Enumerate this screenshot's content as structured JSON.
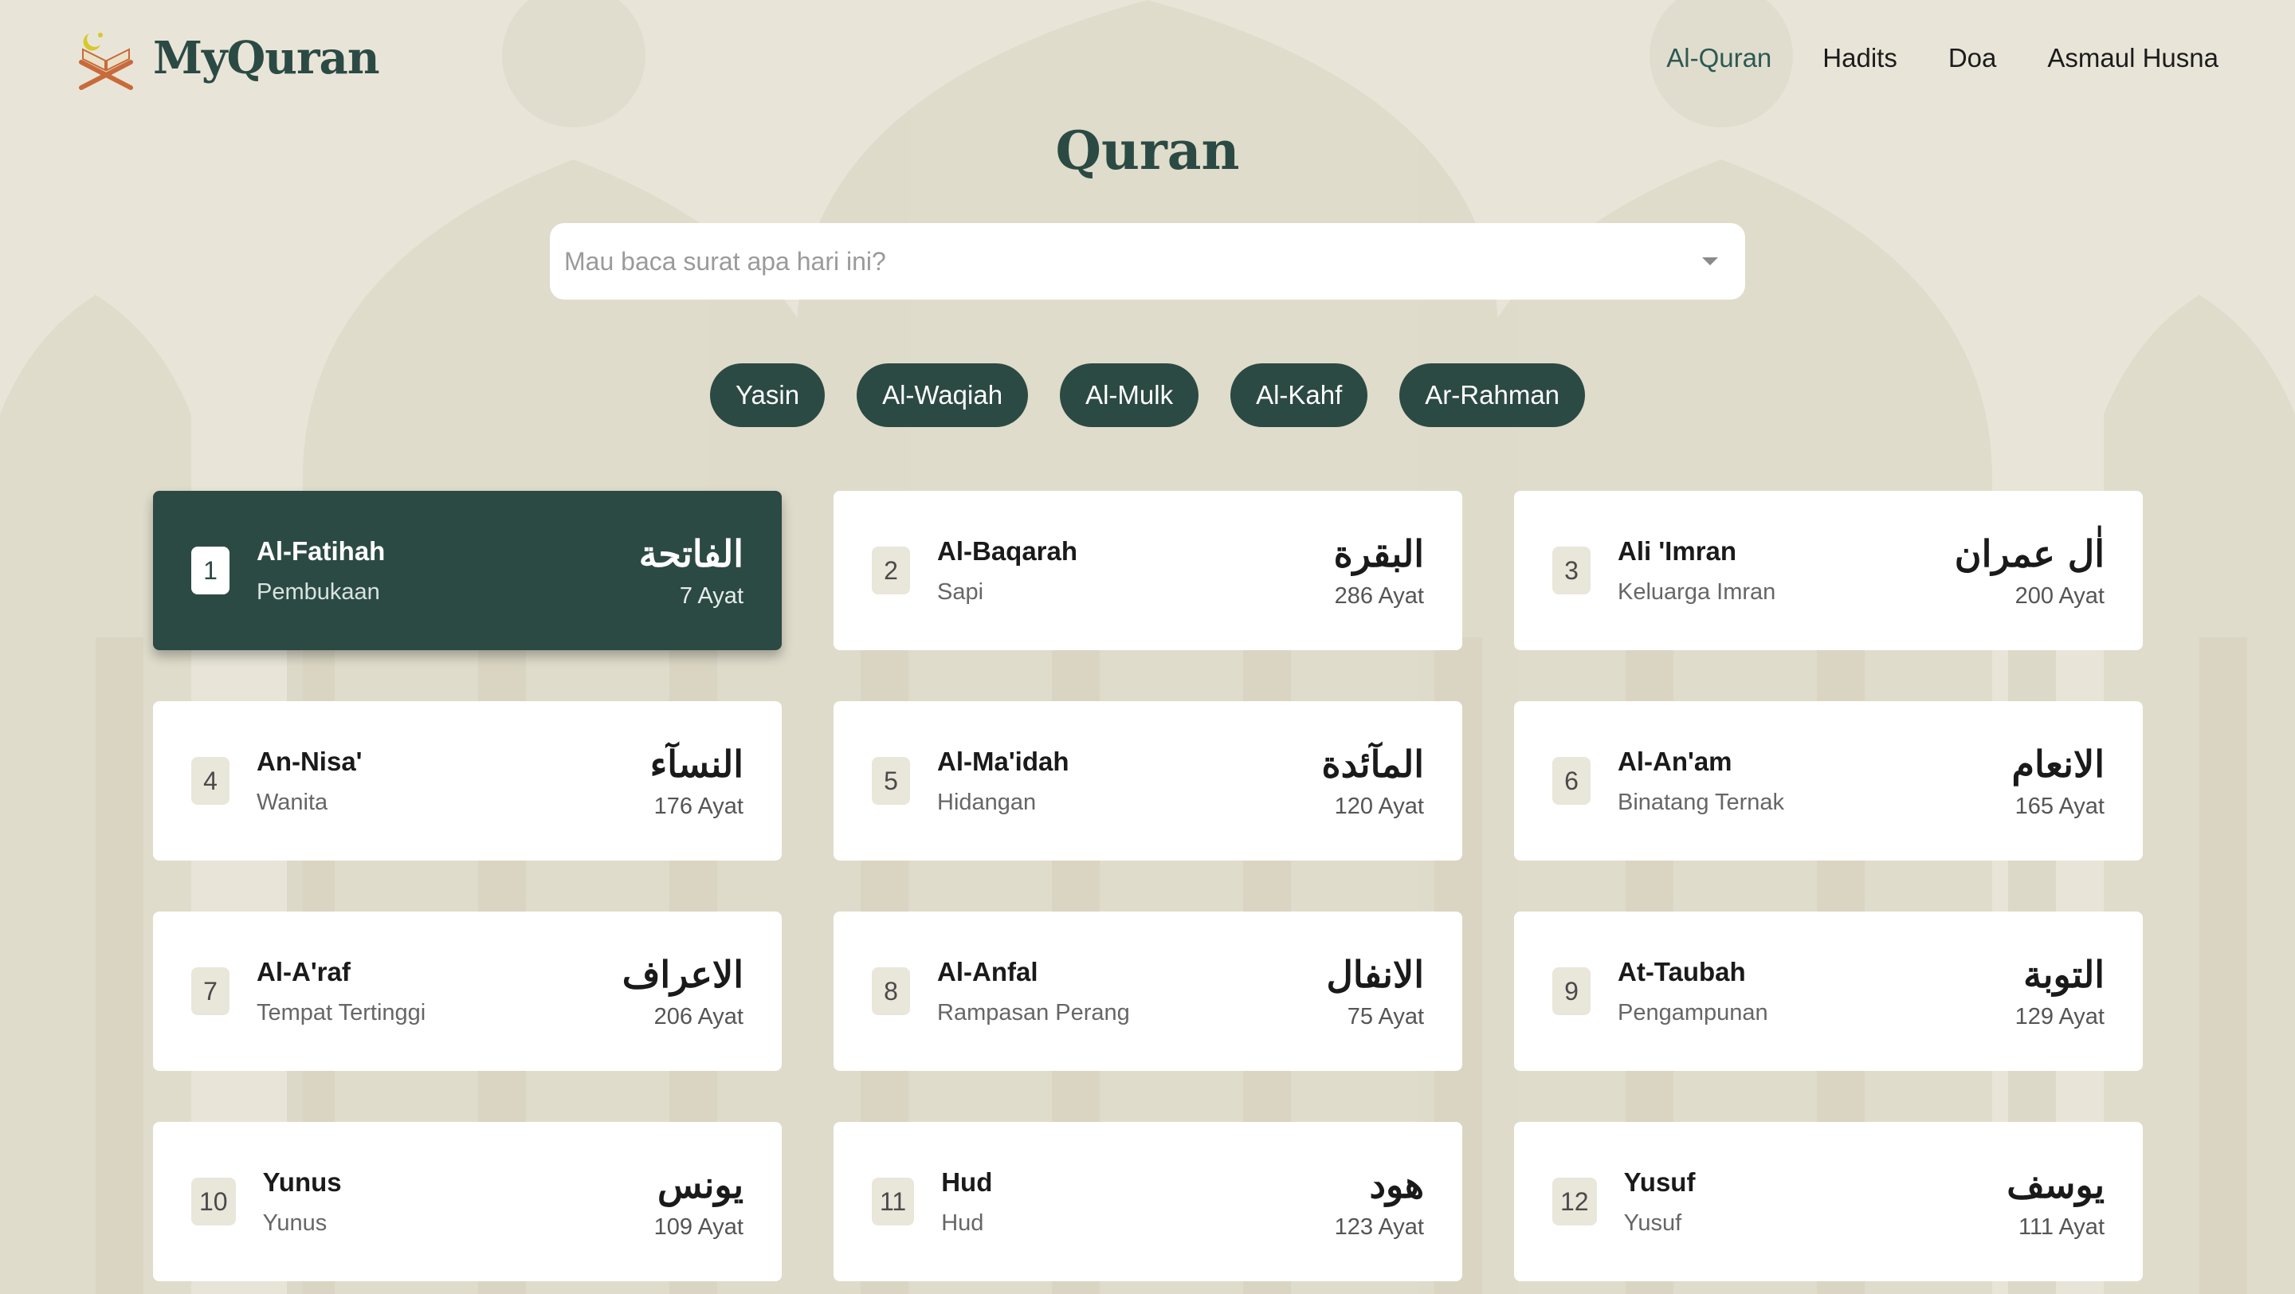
{
  "brand": {
    "name": "MyQuran"
  },
  "nav": {
    "items": [
      {
        "label": "Al-Quran",
        "active": true
      },
      {
        "label": "Hadits",
        "active": false
      },
      {
        "label": "Doa",
        "active": false
      },
      {
        "label": "Asmaul Husna",
        "active": false
      }
    ]
  },
  "page_title": "Quran",
  "search": {
    "placeholder": "Mau baca surat apa hari ini?",
    "value": ""
  },
  "chips": [
    "Yasin",
    "Al-Waqiah",
    "Al-Mulk",
    "Al-Kahf",
    "Ar-Rahman"
  ],
  "colors": {
    "primary": "#2c4a44",
    "background": "#e8e5d8",
    "card": "#ffffff"
  },
  "surahs": [
    {
      "number": "1",
      "name": "Al-Fatihah",
      "meaning": "Pembukaan",
      "arabic": "الفاتحة",
      "ayat": "7 Ayat",
      "active": true
    },
    {
      "number": "2",
      "name": "Al-Baqarah",
      "meaning": "Sapi",
      "arabic": "البقرة",
      "ayat": "286 Ayat"
    },
    {
      "number": "3",
      "name": "Ali 'Imran",
      "meaning": "Keluarga Imran",
      "arabic": "اٰل عمران",
      "ayat": "200 Ayat"
    },
    {
      "number": "4",
      "name": "An-Nisa'",
      "meaning": "Wanita",
      "arabic": "النسآء",
      "ayat": "176 Ayat"
    },
    {
      "number": "5",
      "name": "Al-Ma'idah",
      "meaning": "Hidangan",
      "arabic": "المآئدة",
      "ayat": "120 Ayat"
    },
    {
      "number": "6",
      "name": "Al-An'am",
      "meaning": "Binatang Ternak",
      "arabic": "الانعام",
      "ayat": "165 Ayat"
    },
    {
      "number": "7",
      "name": "Al-A'raf",
      "meaning": "Tempat Tertinggi",
      "arabic": "الاعراف",
      "ayat": "206 Ayat"
    },
    {
      "number": "8",
      "name": "Al-Anfal",
      "meaning": "Rampasan Perang",
      "arabic": "الانفال",
      "ayat": "75 Ayat"
    },
    {
      "number": "9",
      "name": "At-Taubah",
      "meaning": "Pengampunan",
      "arabic": "التوبة",
      "ayat": "129 Ayat"
    },
    {
      "number": "10",
      "name": "Yunus",
      "meaning": "Yunus",
      "arabic": "يونس",
      "ayat": "109 Ayat"
    },
    {
      "number": "11",
      "name": "Hud",
      "meaning": "Hud",
      "arabic": "هود",
      "ayat": "123 Ayat"
    },
    {
      "number": "12",
      "name": "Yusuf",
      "meaning": "Yusuf",
      "arabic": "يوسف",
      "ayat": "111 Ayat"
    }
  ]
}
